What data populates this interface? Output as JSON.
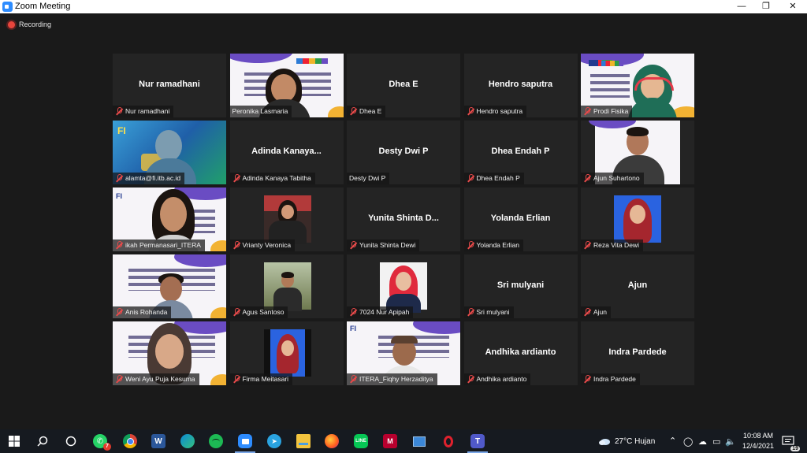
{
  "window": {
    "title": "Zoom Meeting",
    "controls": [
      "minimize",
      "maximize",
      "close"
    ]
  },
  "recording": {
    "label": "Recording"
  },
  "participants": [
    {
      "label": "Nur ramadhani",
      "display": "Nur ramadhani",
      "muted": true,
      "video": false
    },
    {
      "label": "Peronika Lasmaria",
      "display": "",
      "muted": false,
      "video": true,
      "active_speaker": true
    },
    {
      "label": "Dhea E",
      "display": "Dhea E",
      "muted": true,
      "video": false
    },
    {
      "label": "Hendro saputra",
      "display": "Hendro saputra",
      "muted": true,
      "video": false
    },
    {
      "label": "Prodi Fisika",
      "display": "",
      "muted": true,
      "video": true
    },
    {
      "label": "alamta@fi.itb.ac.id",
      "display": "",
      "muted": true,
      "video": true
    },
    {
      "label": "Adinda Kanaya Tabitha",
      "display": "Adinda  Kanaya...",
      "muted": true,
      "video": false
    },
    {
      "label": "Desty Dwi P",
      "display": "Desty Dwi P",
      "muted": false,
      "video": false
    },
    {
      "label": "Dhea Endah P",
      "display": "Dhea Endah P",
      "muted": true,
      "video": false
    },
    {
      "label": "Ajun Suhartono",
      "display": "",
      "muted": true,
      "video": true
    },
    {
      "label": "ikah Permanasari_ITERA",
      "display": "",
      "muted": true,
      "video": true
    },
    {
      "label": "Vrianty Veronica",
      "display": "",
      "muted": true,
      "video": true
    },
    {
      "label": "Yunita Shinta Dewi",
      "display": "Yunita  Shinta  D...",
      "muted": true,
      "video": false
    },
    {
      "label": "Yolanda Erlian",
      "display": "Yolanda Erlian",
      "muted": true,
      "video": false
    },
    {
      "label": "Reza Vita Dewi",
      "display": "",
      "muted": true,
      "video": true
    },
    {
      "label": "Anis Rohanda",
      "display": "",
      "muted": true,
      "video": true
    },
    {
      "label": "Agus Santoso",
      "display": "",
      "muted": true,
      "video": true
    },
    {
      "label": "7024 Nur Apipah",
      "display": "",
      "muted": true,
      "video": true
    },
    {
      "label": "Sri mulyani",
      "display": "Sri mulyani",
      "muted": true,
      "video": false
    },
    {
      "label": "Ajun",
      "display": "Ajun",
      "muted": true,
      "video": false
    },
    {
      "label": "Weni Ayu Puja Kesuma",
      "display": "",
      "muted": true,
      "video": true
    },
    {
      "label": "Firma Meitasari",
      "display": "",
      "muted": true,
      "video": true
    },
    {
      "label": "ITERA_Fiqhy Herzaditya",
      "display": "",
      "muted": true,
      "video": true
    },
    {
      "label": "Andhika ardianto",
      "display": "Andhika ardianto",
      "muted": true,
      "video": false
    },
    {
      "label": "Indra Pardede",
      "display": "Indra Pardede",
      "muted": true,
      "video": false
    }
  ],
  "taskbar": {
    "weather": "27°C  Hujan",
    "time": "10:08 AM",
    "date": "12/4/2021",
    "notification_count": "19",
    "whatsapp_badge": "7",
    "apps": [
      "windows-start",
      "search",
      "task-view",
      "whatsapp",
      "chrome",
      "word",
      "edge",
      "spotify",
      "zoom",
      "telegram",
      "file-explorer",
      "firefox",
      "line",
      "mendeley",
      "app-blue",
      "opera",
      "teams"
    ]
  },
  "colors": {
    "background": "#1a1a1a",
    "tile": "#242424",
    "active_speaker_border": "#dede52",
    "muted_icon": "#e84a4a"
  }
}
